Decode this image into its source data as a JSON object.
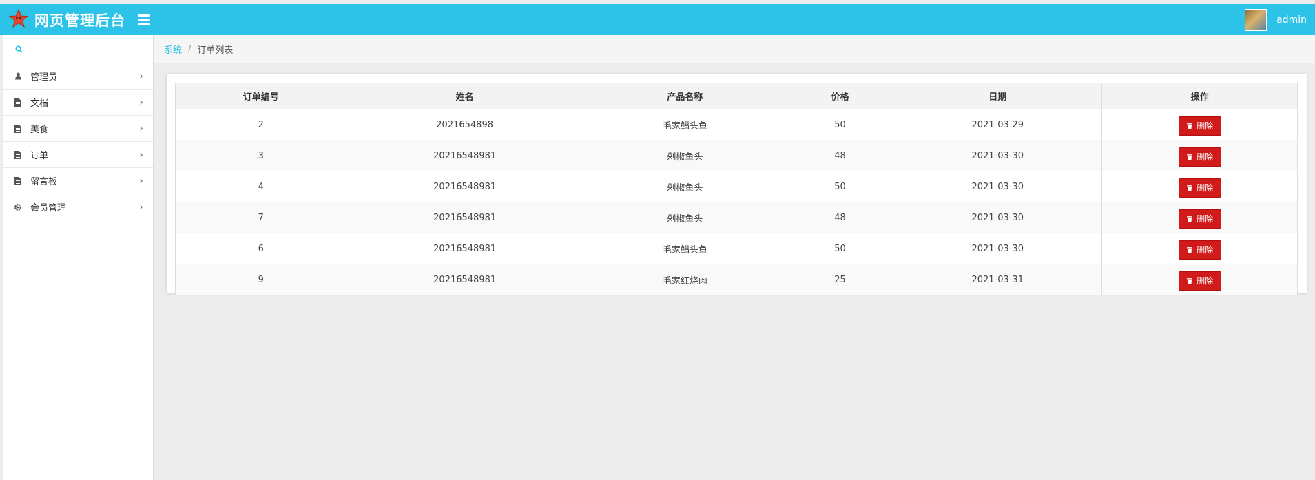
{
  "app": {
    "title": "网页管理后台",
    "brand_color": "#2dc3e8",
    "user": "admin"
  },
  "sidebar": {
    "search_icon": "search-icon",
    "items": [
      {
        "label": "管理员",
        "icon": "user-icon"
      },
      {
        "label": "文档",
        "icon": "document-icon"
      },
      {
        "label": "美食",
        "icon": "document-icon"
      },
      {
        "label": "订单",
        "icon": "document-icon"
      },
      {
        "label": "留言板",
        "icon": "document-icon"
      },
      {
        "label": "会员管理",
        "icon": "gear-icon"
      }
    ]
  },
  "breadcrumb": {
    "root": "系统",
    "current": "订单列表"
  },
  "table": {
    "headers": [
      "订单编号",
      "姓名",
      "产品名称",
      "价格",
      "日期",
      "操作"
    ],
    "rows": [
      {
        "id": "2",
        "name": "2021654898",
        "product": "毛家鲳头鱼",
        "price": "50",
        "date": "2021-03-29"
      },
      {
        "id": "3",
        "name": "20216548981",
        "product": "剁椒鱼头",
        "price": "48",
        "date": "2021-03-30"
      },
      {
        "id": "4",
        "name": "20216548981",
        "product": "剁椒鱼头",
        "price": "50",
        "date": "2021-03-30"
      },
      {
        "id": "7",
        "name": "20216548981",
        "product": "剁椒鱼头",
        "price": "48",
        "date": "2021-03-30"
      },
      {
        "id": "6",
        "name": "20216548981",
        "product": "毛家鲳头鱼",
        "price": "50",
        "date": "2021-03-30"
      },
      {
        "id": "9",
        "name": "20216548981",
        "product": "毛家红烧肉",
        "price": "25",
        "date": "2021-03-31"
      }
    ],
    "delete_label": "删除",
    "delete_color": "#d11b1b"
  }
}
